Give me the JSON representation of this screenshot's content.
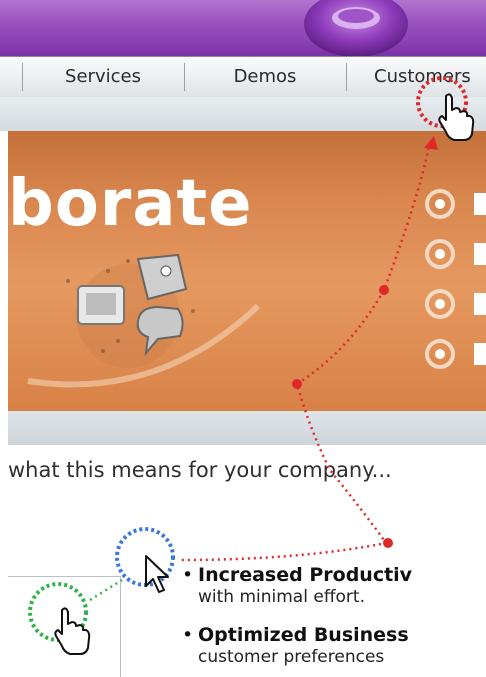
{
  "nav": {
    "items": [
      {
        "label": "Services"
      },
      {
        "label": "Demos"
      },
      {
        "label": "Customers"
      }
    ]
  },
  "banner": {
    "headline": "borate"
  },
  "content": {
    "subheading": "what this means for your company...",
    "bullets": [
      {
        "title": "Increased Productiv",
        "text": "with minimal effort."
      },
      {
        "title": "Optimized Business",
        "text": "customer preferences"
      }
    ]
  },
  "colors": {
    "brand_purple": "#9a4fc0",
    "banner_orange": "#d9874f",
    "click_red": "#e0282b",
    "hover_blue": "#3a78d8",
    "click_green": "#2db34a"
  },
  "icons": [
    "hand-pointer-icon",
    "arrow-cursor-icon",
    "collaboration-icon",
    "radio-bullet-icon"
  ]
}
